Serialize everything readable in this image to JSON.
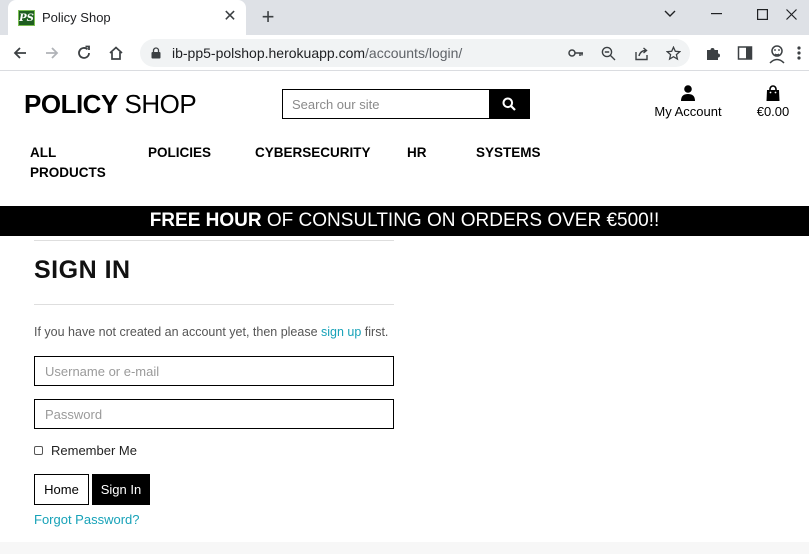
{
  "browser": {
    "tab_title": "Policy Shop",
    "favicon_text": "PS",
    "url_host": "ib-pp5-polshop.herokuapp.com",
    "url_path": "/accounts/login/",
    "icons": [
      "back-icon",
      "forward-icon",
      "reload-icon",
      "home-icon",
      "lock-icon",
      "key-icon",
      "zoom-out-icon",
      "share-icon",
      "star-icon",
      "extensions-icon",
      "sidepanel-icon",
      "profile-icon"
    ]
  },
  "header": {
    "logo_bold": "POLICY",
    "logo_light": "SHOP",
    "search_placeholder": "Search our site",
    "account_label": "My Account",
    "cart_total": "€0.00"
  },
  "nav": {
    "items": [
      "ALL",
      "PRODUCTS",
      "POLICIES",
      "CYBERSECURITY",
      "HR",
      "SYSTEMS"
    ]
  },
  "banner": {
    "bold": "FREE HOUR",
    "rest": " OF CONSULTING ON ORDERS OVER €500!!"
  },
  "signin": {
    "title": "SIGN IN",
    "hint_prefix": "If you have not created an account yet, then please ",
    "hint_link": "sign up",
    "hint_suffix": " first.",
    "username_placeholder": "Username or e-mail",
    "password_placeholder": "Password",
    "remember_label": "Remember Me",
    "home_button": "Home",
    "signin_button": "Sign In",
    "forgot_link": "Forgot Password?"
  },
  "colors": {
    "accent_link": "#17a2b8",
    "banner_bg": "#000000",
    "favicon_bg": "#1e5e20"
  }
}
